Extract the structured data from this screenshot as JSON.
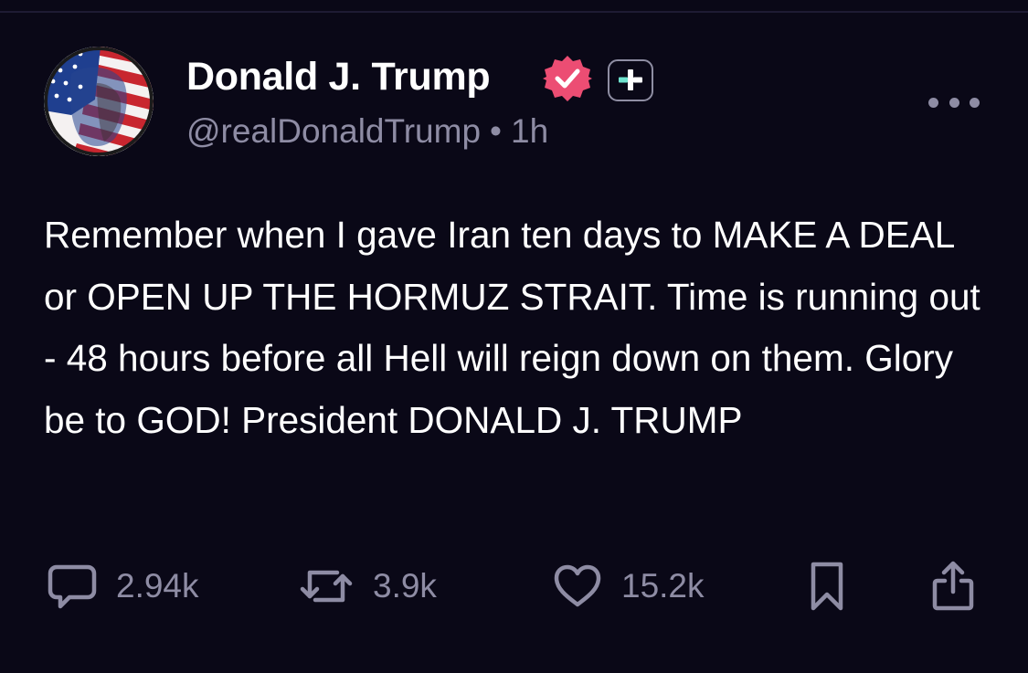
{
  "post": {
    "author": {
      "display_name": "Donald J. Trump",
      "handle": "@realDonaldTrump",
      "verified": true,
      "avatar_icon": "avatar-flag-portrait"
    },
    "separator": "•",
    "timestamp": "1h",
    "text": "Remember when I gave Iran ten days to MAKE A DEAL or OPEN UP THE HORMUZ STRAIT. Time is running out - 48 hours before all Hell will reign down on them. Glory be to GOD! President DONALD J. TRUMP",
    "actions": {
      "replies": {
        "icon": "reply-icon",
        "count": "2.94k"
      },
      "reposts": {
        "icon": "repost-icon",
        "count": "3.9k"
      },
      "likes": {
        "icon": "heart-icon",
        "count": "15.2k"
      },
      "bookmark": {
        "icon": "bookmark-icon"
      },
      "share": {
        "icon": "share-icon"
      }
    },
    "more_icon": "more-horizontal-icon"
  },
  "colors": {
    "background": "#0a0817",
    "text_primary": "#ffffff",
    "text_secondary": "#8e8ca4",
    "verified_badge": "#ec4d73",
    "plus_accent": "#6fe3cf"
  }
}
